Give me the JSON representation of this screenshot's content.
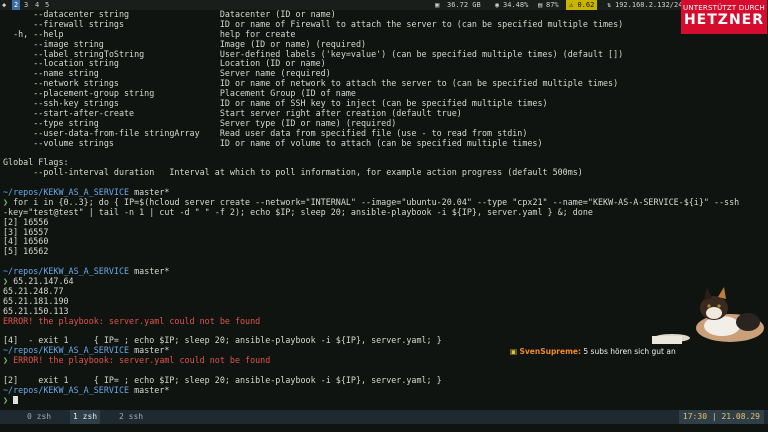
{
  "topbar": {
    "workspaces": [
      "1",
      "2",
      "3",
      "4",
      "5"
    ],
    "active_workspace": "2",
    "disk": "36.72 GB",
    "cpu": "34.48%",
    "mem": "87%",
    "load": "0.62",
    "ip": "192.168.2.132/24"
  },
  "logo": {
    "tagline": "UNTERSTÜTZT DURCH",
    "name": "HETZNER"
  },
  "terminal_lines": [
    {
      "t": "      --datacenter string                  Datacenter (ID or name)"
    },
    {
      "t": "      --firewall strings                   ID or name of Firewall to attach the server to (can be specified multiple times)"
    },
    {
      "t": "  -h, --help                               help for create"
    },
    {
      "t": "      --image string                       Image (ID or name) (required)"
    },
    {
      "t": "      --label stringToString               User-defined labels ('key=value') (can be specified multiple times) (default [])"
    },
    {
      "t": "      --location string                    Location (ID or name)"
    },
    {
      "t": "      --name string                        Server name (required)"
    },
    {
      "t": "      --network strings                    ID or name of network to attach the server to (can be specified multiple times)"
    },
    {
      "t": "      --placement-group string             Placement Group (ID of name"
    },
    {
      "t": "      --ssh-key strings                    ID or name of SSH key to inject (can be specified multiple times)"
    },
    {
      "t": "      --start-after-create                 Start server right after creation (default true)"
    },
    {
      "t": "      --type string                        Server type (ID or name) (required)"
    },
    {
      "t": "      --user-data-from-file stringArray    Read user data from specified file (use - to read from stdin)"
    },
    {
      "t": "      --volume strings                     ID or name of volume to attach (can be specified multiple times)"
    },
    {
      "t": ""
    },
    {
      "t": "Global Flags:"
    },
    {
      "t": "      --poll-interval duration   Interval at which to poll information, for example action progress (default 500ms)"
    },
    {
      "t": ""
    },
    {
      "kind": "prompt",
      "path": "~/repos/KEKW_AS_A_SERVICE",
      "branch": " master*"
    },
    {
      "kind": "cmd",
      "t": "for i in {0..3}; do { IP=$(hcloud server create --network=\"INTERNAL\" --image=\"ubuntu-20.04\" --type \"cpx21\" --name=\"KEKW-AS-A-SERVICE-${i}\" --ssh"
    },
    {
      "t": "-key=\"test@test\" | tail -n 1 | cut -d \" \" -f 2); echo $IP; sleep 20; ansible-playbook -i ${IP}, server.yaml } &; done"
    },
    {
      "t": "[2] 16556"
    },
    {
      "t": "[3] 16557"
    },
    {
      "t": "[4] 16560"
    },
    {
      "t": "[5] 16562"
    },
    {
      "t": ""
    },
    {
      "kind": "prompt",
      "path": "~/repos/KEKW_AS_A_SERVICE",
      "branch": " master*"
    },
    {
      "kind": "cmd",
      "t": "65.21.147.64"
    },
    {
      "t": "65.21.248.77"
    },
    {
      "t": "65.21.181.190"
    },
    {
      "t": "65.21.150.113"
    },
    {
      "kind": "err",
      "t": "ERROR! the playbook: server.yaml could not be found"
    },
    {
      "t": ""
    },
    {
      "t": "[4]  - exit 1     { IP= ; echo $IP; sleep 20; ansible-playbook -i ${IP}, server.yaml; }"
    },
    {
      "kind": "prompt",
      "path": "~/repos/KEKW_AS_A_SERVICE",
      "branch": " master*"
    },
    {
      "kind": "cmderr",
      "t": "ERROR! the playbook: server.yaml could not be found"
    },
    {
      "t": ""
    },
    {
      "t": "[2]    exit 1     { IP= ; echo $IP; sleep 20; ansible-playbook -i ${IP}, server.yaml; }"
    },
    {
      "kind": "prompt",
      "path": "~/repos/KEKW_AS_A_SERVICE",
      "branch": " master*"
    },
    {
      "kind": "cursor",
      "t": ""
    }
  ],
  "chat": {
    "user": "SvenSupreme:",
    "message": " 5 subs hören sich gut an"
  },
  "tmux": {
    "windows": [
      {
        "index": "0",
        "name": "zsh"
      },
      {
        "index": "1",
        "name": "zsh"
      },
      {
        "index": "2",
        "name": "ssh"
      }
    ],
    "active_window": "1",
    "time": "17:30",
    "date": "21.08.29"
  },
  "colors": {
    "prompt_path": "#6aa8e8",
    "prompt_arrow": "#7bc46b",
    "error": "#e0534a",
    "logo_bg": "#d50c2d"
  }
}
